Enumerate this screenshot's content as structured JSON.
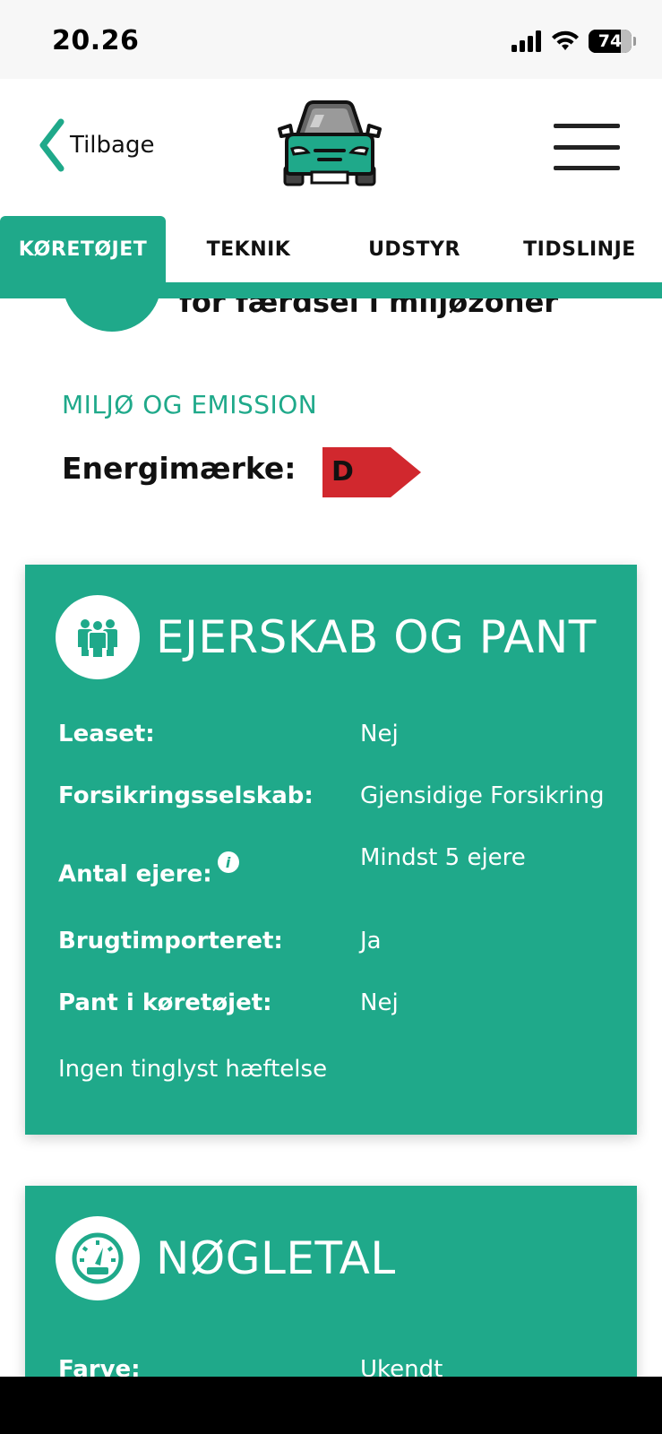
{
  "status_bar": {
    "time": "20.26",
    "battery": "74",
    "battery_level": 0.74
  },
  "header": {
    "back_label": "Tilbage",
    "logo": "car-logo-icon",
    "menu": "hamburger-menu-icon"
  },
  "tabs": [
    {
      "label": "KØRETØJET",
      "active": true
    },
    {
      "label": "TEKNIK",
      "active": false
    },
    {
      "label": "UDSTYR",
      "active": false
    },
    {
      "label": "TIDSLINJE",
      "active": false
    }
  ],
  "scrolled_fragment_text": "for færdsel i miljøzoner",
  "environment": {
    "section_title": "MILJØ OG EMISSION",
    "energy_label": "Energimærke:",
    "energy_value": "D",
    "energy_color": "#d1282e"
  },
  "ownership": {
    "title": "EJERSKAB OG PANT",
    "icon": "people-group-icon",
    "rows": [
      {
        "label": "Leaset:",
        "value": "Nej"
      },
      {
        "label": "Forsikringsselskab:",
        "value": "Gjensidige Forsikring"
      },
      {
        "label": "Antal ejere:",
        "value": "Mindst 5 ejere",
        "info": "i"
      },
      {
        "label": "Brugtimporteret:",
        "value": "Ja"
      },
      {
        "label": "Pant i køretøjet:",
        "value": "Nej"
      }
    ],
    "note": "Ingen tinglyst hæftelse"
  },
  "key_figures": {
    "title": "NØGLETAL",
    "icon": "speedometer-icon",
    "rows": [
      {
        "label": "Farve:",
        "value": "Ukendt"
      }
    ]
  },
  "colors": {
    "accent": "#1fa98a",
    "text": "#111111"
  }
}
